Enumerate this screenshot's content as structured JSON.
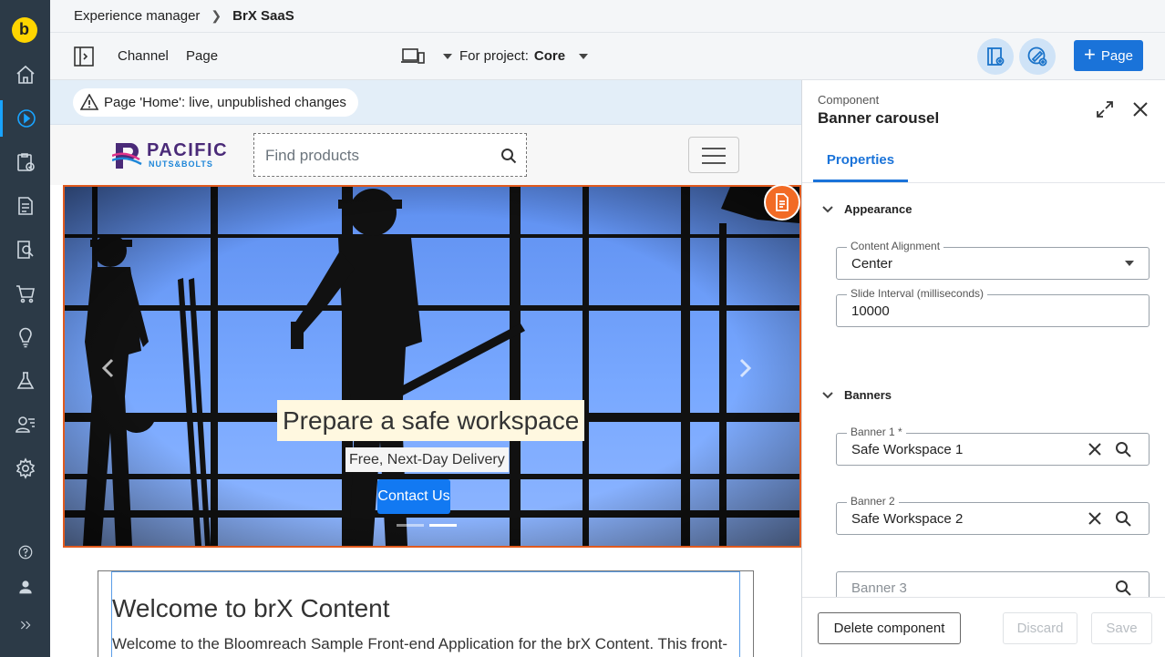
{
  "breadcrumbs": {
    "root": "Experience manager",
    "current": "BrX SaaS"
  },
  "toolbar": {
    "channel_label": "Channel",
    "page_label": "Page",
    "project_prefix": "For project:",
    "project_value": "Core",
    "add_page_label": "Page"
  },
  "notice": {
    "text": "Page 'Home': live, unpublished changes"
  },
  "rail": {
    "items": [
      "home-icon",
      "experience-manager-icon",
      "projects-icon",
      "content-icon",
      "search-audit-icon",
      "commerce-icon",
      "insights-icon",
      "experiments-icon",
      "users-icon",
      "settings-icon"
    ],
    "bottom": [
      "help-icon",
      "user-icon",
      "expand-icon"
    ],
    "logo": "b"
  },
  "site": {
    "brand_top": "PACIFIC",
    "brand_bottom": "NUTS&BOLTS",
    "search_placeholder": "Find products",
    "slide_title": "Prepare a safe workspace",
    "slide_subtitle": "Free, Next-Day Delivery",
    "slide_cta": "Contact Us",
    "welcome_title": "Welcome to brX Content",
    "welcome_body": "Welcome to the Bloomreach Sample Front-end Application for the brX Content. This front-end"
  },
  "panel": {
    "kicker": "Component",
    "title": "Banner carousel",
    "tab": "Properties",
    "sections": {
      "appearance": "Appearance",
      "banners": "Banners"
    },
    "fields": {
      "alignment": {
        "label": "Content Alignment",
        "value": "Center"
      },
      "interval": {
        "label": "Slide Interval (milliseconds)",
        "value": "10000"
      },
      "banner1": {
        "label": "Banner 1 *",
        "value": "Safe Workspace 1"
      },
      "banner2": {
        "label": "Banner 2",
        "value": "Safe Workspace 2"
      },
      "banner3": {
        "placeholder": "Banner 3"
      }
    },
    "footer": {
      "delete": "Delete component",
      "discard": "Discard",
      "save": "Save"
    }
  },
  "colors": {
    "accent": "#1a73d9",
    "rail": "#2c3a47",
    "edit_badge": "#f26b25",
    "cta": "#1279f2"
  }
}
